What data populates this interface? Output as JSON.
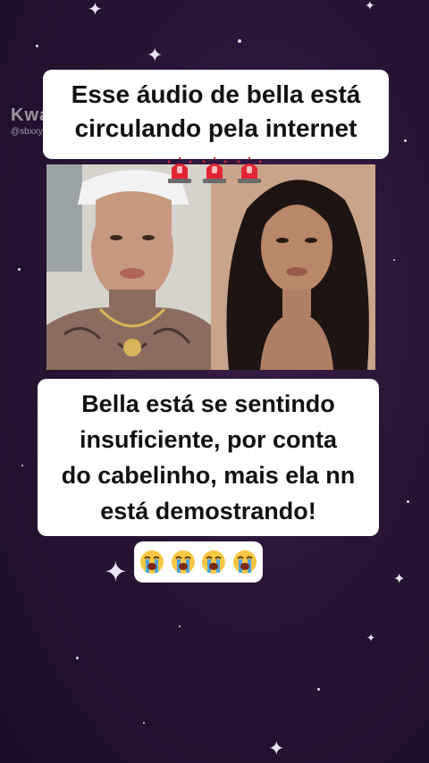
{
  "background": {
    "color": "#2a1436",
    "star_color": "#e9e3f2"
  },
  "watermark": {
    "logo": "Kwai",
    "handle": "@sbxxy..."
  },
  "top_caption": {
    "lines": [
      "Esse áudio de bella está",
      "circulando pela internet"
    ],
    "emoji_icons": [
      "police-siren-icon",
      "police-siren-icon",
      "police-siren-icon"
    ]
  },
  "photos": {
    "left": {
      "icon": "man-with-tattoos-photo"
    },
    "right": {
      "icon": "woman-long-dark-hair-photo"
    }
  },
  "mid_caption": {
    "lines": [
      "Bella está  se sentindo",
      "insuficiente, por conta",
      "do cabelinho, mais ela nn",
      "está demostrando!"
    ]
  },
  "emoji_row": {
    "icons": [
      "loudly-crying-face-icon",
      "loudly-crying-face-icon",
      "loudly-crying-face-icon",
      "loudly-crying-face-icon"
    ]
  }
}
